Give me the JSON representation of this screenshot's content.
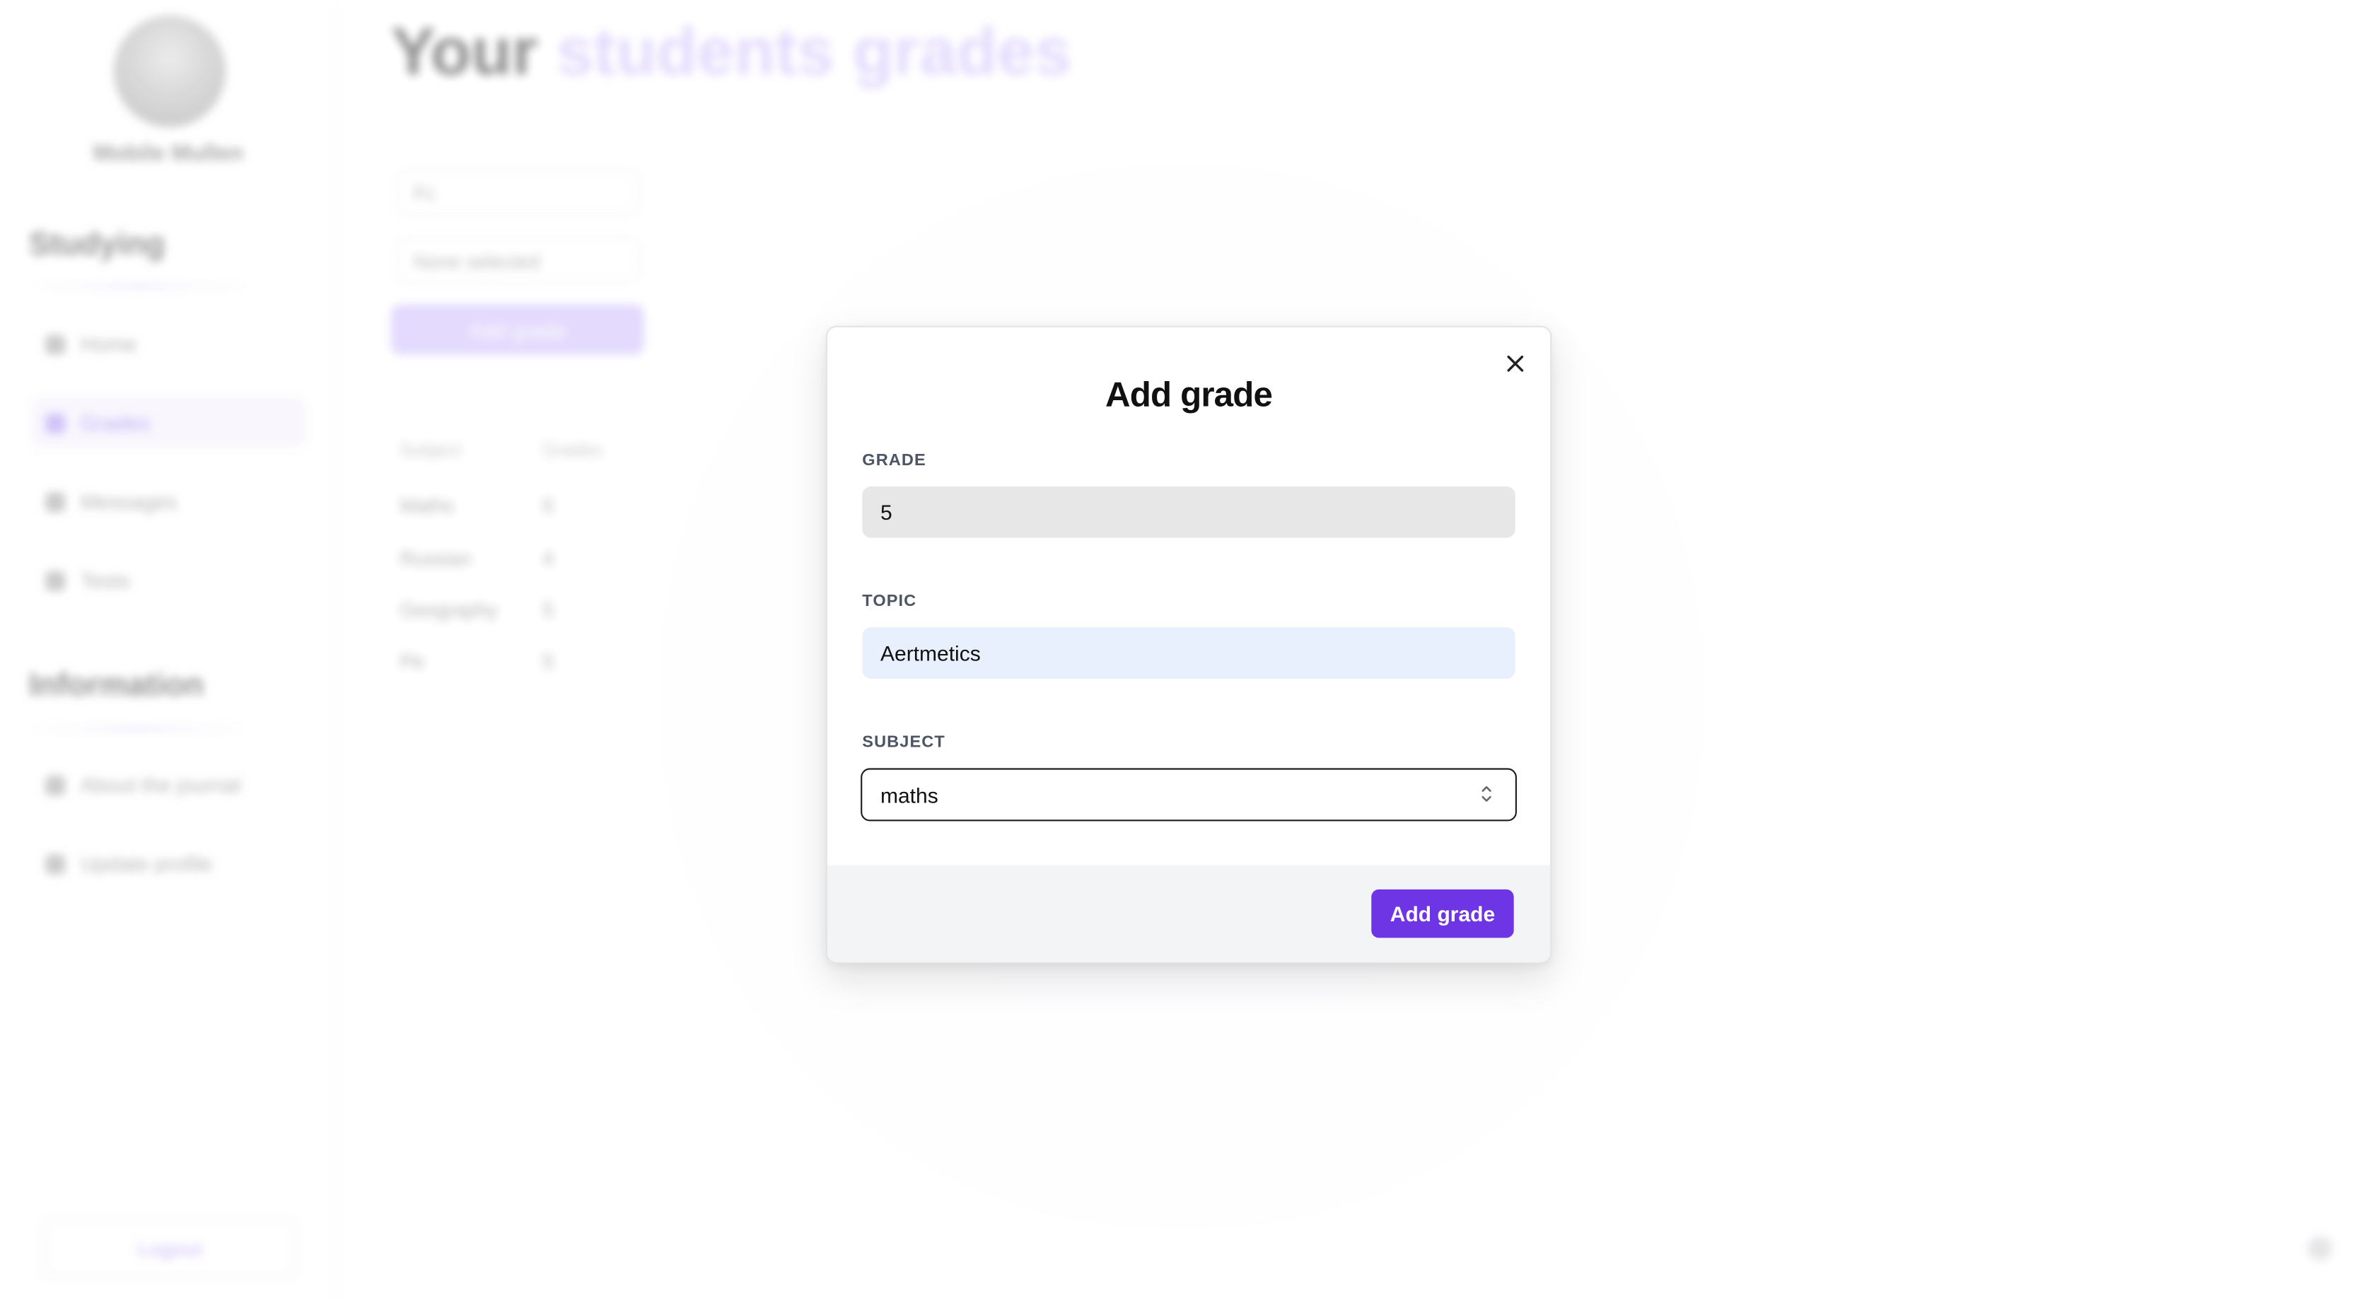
{
  "background": {
    "user_name": "Mobile Mullen",
    "sidebar": {
      "studying_title": "Studying",
      "studying_items": [
        {
          "label": "Home"
        },
        {
          "label": "Grades"
        },
        {
          "label": "Messages"
        },
        {
          "label": "Tests"
        }
      ],
      "information_title": "Information",
      "information_items": [
        {
          "label": "About the journal"
        },
        {
          "label": "Update profile"
        }
      ],
      "logout_label": "Logout"
    },
    "page_title": {
      "prefix": "Your",
      "accent": "students grades"
    },
    "filters": {
      "student_select": "Fc",
      "subject_select": "None selected"
    },
    "add_grade_button": "Add grade",
    "table": {
      "headers": [
        "Subject",
        "Grades"
      ],
      "rows": [
        {
          "subject": "Maths",
          "grades": "5"
        },
        {
          "subject": "Russian",
          "grades": "4"
        },
        {
          "subject": "Geography",
          "grades": "5"
        },
        {
          "subject": "Pe",
          "grades": "5"
        }
      ]
    }
  },
  "modal": {
    "title": "Add grade",
    "grade": {
      "label": "GRADE",
      "value": "5"
    },
    "topic": {
      "label": "TOPIC",
      "value": "Aertmetics"
    },
    "subject": {
      "label": "SUBJECT",
      "selected": "maths"
    },
    "submit_label": "Add grade",
    "close_icon": "close-icon",
    "accent_color": "#6d35e3"
  }
}
